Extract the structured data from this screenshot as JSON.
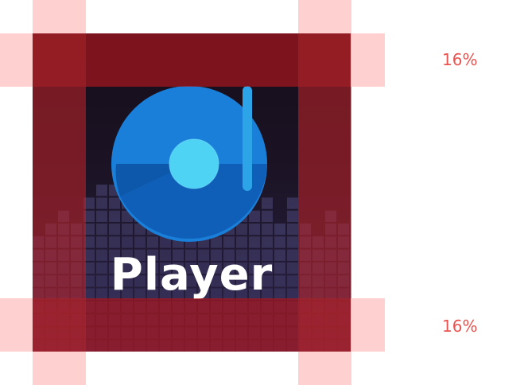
{
  "app_tile": {
    "title": "Player",
    "icon": "disc-icon",
    "colors": {
      "disc_outer": "#1a7fd8",
      "disc_inner": "#0f5fb8",
      "disc_center": "#4fd3f5",
      "needle": "#2ea4e8",
      "background": "#1c1426"
    }
  },
  "safe_area": {
    "top_label": "16%",
    "bottom_label": "16%",
    "guide_color": "#e8534f"
  }
}
